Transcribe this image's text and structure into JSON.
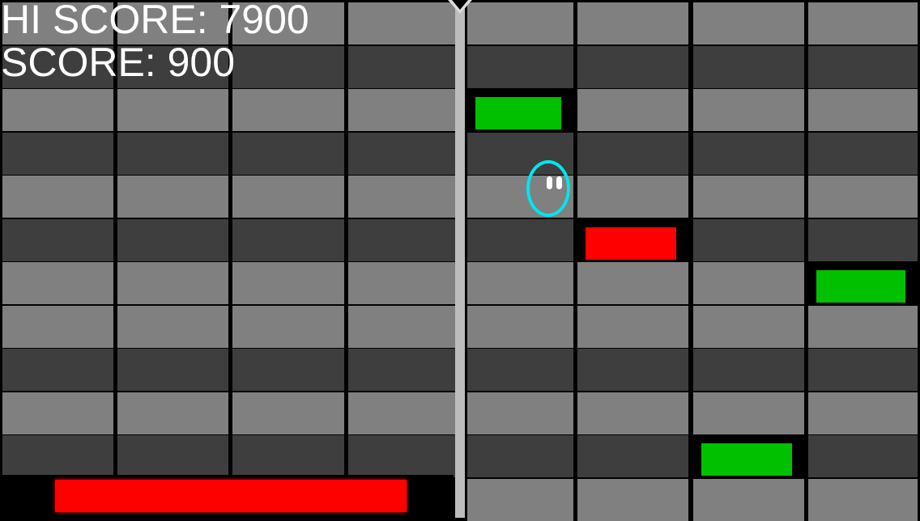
{
  "hud": {
    "hi_score_label": "HI SCORE: 7900",
    "score_label": "SCORE: 900"
  },
  "colors": {
    "tile_light": "#808080",
    "tile_dark": "#3e3e3e",
    "block_green": "#00c000",
    "block_red": "#ff0000",
    "player_outline": "#00e5ee",
    "divider": "#bdbdbd"
  },
  "left_grid": {
    "rows": [
      "light",
      "dark",
      "light",
      "dark",
      "light",
      "dark",
      "light",
      "light",
      "dark",
      "light",
      "dark"
    ]
  },
  "right_grid": {
    "rows": [
      "light",
      "dark",
      "light",
      "dark",
      "light",
      "dark",
      "light",
      "light",
      "dark",
      "light",
      "dark",
      "light"
    ],
    "blocks": [
      {
        "row": 2,
        "col": 0,
        "color": "green"
      },
      {
        "row": 5,
        "col": 1,
        "color": "red"
      },
      {
        "row": 6,
        "col": 3,
        "color": "green"
      },
      {
        "row": 10,
        "col": 2,
        "color": "green"
      }
    ]
  },
  "player": {
    "icon": "ghost-character-icon"
  },
  "power_bar": {
    "level": 0.775,
    "color": "red"
  }
}
